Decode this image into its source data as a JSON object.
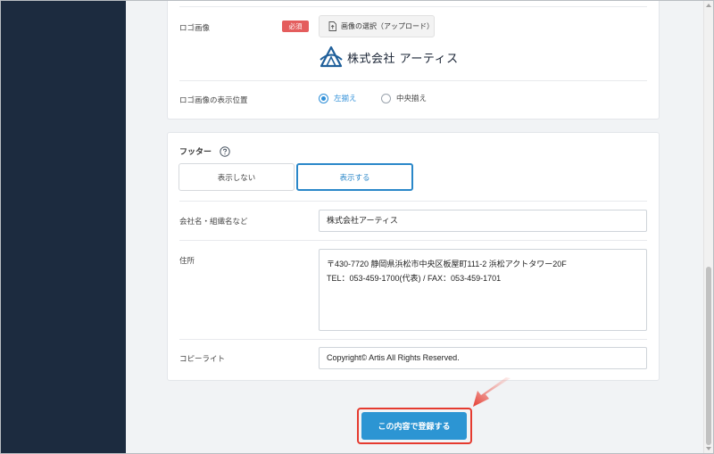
{
  "logo_section": {
    "label": "ロゴ画像",
    "required_badge": "必須",
    "upload_button": "画像の選択（アップロード）",
    "logo_text": "株式会社 アーティス",
    "position_label": "ロゴ画像の表示位置",
    "position_options": [
      {
        "label": "左揃え",
        "selected": true
      },
      {
        "label": "中央揃え",
        "selected": false
      }
    ]
  },
  "footer_section": {
    "title": "フッター",
    "help_icon": "question-circle-icon",
    "toggle_off": "表示しない",
    "toggle_on": "表示する",
    "company_label": "会社名・組織名など",
    "company_value": "株式会社アーティス",
    "address_label": "住所",
    "address_line1": "〒430-7720 静岡県浜松市中央区板屋町111-2 浜松アクトタワー20F",
    "address_line2": "TEL：053-459-1700(代表) / FAX：053-459-1701",
    "copyright_label": "コピーライト",
    "copyright_value": "Copyright© Artis All Rights Reserved."
  },
  "submit_button": "この内容で登録する",
  "colors": {
    "sidebar": "#1c2b3f",
    "accent": "#2c95d3",
    "required": "#e45d5d",
    "highlight": "#e53a2f"
  }
}
